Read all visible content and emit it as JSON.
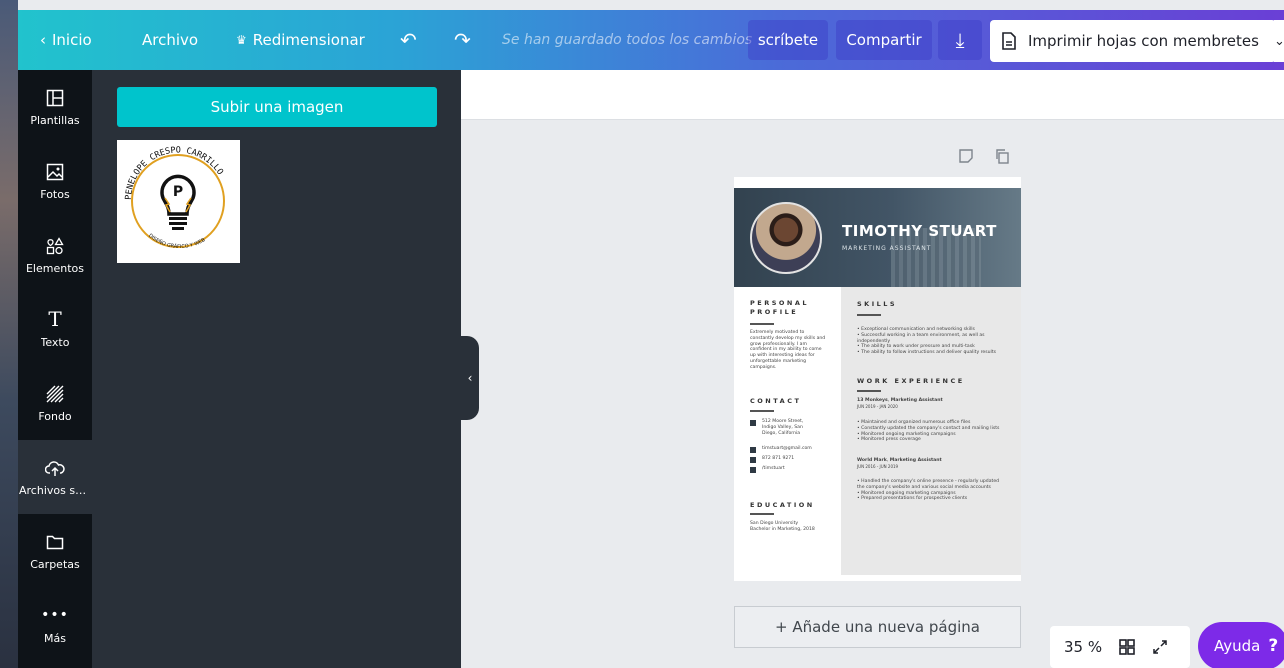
{
  "topbar": {
    "back_label": "Inicio",
    "archivo_label": "Archivo",
    "resize_label": "Redimensionar",
    "saved_status": "Se han guardado todos los cambios",
    "subscribe_label": "scríbete",
    "share_label": "Compartir",
    "print_label": "Imprimir hojas con membretes"
  },
  "rail": {
    "items": [
      {
        "label": "Plantillas",
        "icon": "template-icon"
      },
      {
        "label": "Fotos",
        "icon": "photo-icon"
      },
      {
        "label": "Elementos",
        "icon": "elements-icon"
      },
      {
        "label": "Texto",
        "icon": "text-icon"
      },
      {
        "label": "Fondo",
        "icon": "background-icon"
      },
      {
        "label": "Archivos su...",
        "icon": "upload-icon"
      },
      {
        "label": "Carpetas",
        "icon": "folder-icon"
      },
      {
        "label": "Más",
        "icon": "more-icon"
      }
    ]
  },
  "panel": {
    "upload_label": "Subir una imagen",
    "logo_text_top": "PENELOPE CRESPO CARRILLO",
    "logo_text_bottom": "DISEÑO GRÁFICO Y WEB",
    "logo_letter": "P"
  },
  "resume": {
    "name": "TIMOTHY STUART",
    "role": "MARKETING ASSISTANT",
    "profile_title": "PERSONAL PROFILE",
    "profile_text": "Extremely motivated to constantly develop my skills and grow professionally. I am confident in my ability to come up with interesting ideas for unforgettable marketing campaigns.",
    "contact_title": "CONTACT",
    "address": "512 Moore Street, Indigo Valley, San Diego, California",
    "email": "timstuart@gmail.com",
    "phone": "872 871 9271",
    "linkedin": "/timstuart",
    "education_title": "EDUCATION",
    "education_school": "San Diego University",
    "education_degree": "Bachelor in Marketing, 2018",
    "skills_title": "SKILLS",
    "skills": [
      "Exceptional communication and networking skills",
      "Successful working in a team environment, as well as independently",
      "The ability to work under pressure and multi-task",
      "The ability to follow instructions and deliver quality results"
    ],
    "work_title": "WORK EXPERIENCE",
    "job1_company": "13 Monkeys",
    "job1_role": "Marketing Assistant",
    "job1_dates": "JUN 2019 - JAN 2020",
    "job1_bullets": [
      "Maintained and organized numerous office files",
      "Constantly updated the company's contact and mailing lists",
      "Monitored ongoing marketing campaigns",
      "Monitored press coverage"
    ],
    "job2_company": "World Mark",
    "job2_role": "Marketing Assistant",
    "job2_dates": "JUN 2016 - JUN 2019",
    "job2_bullets": [
      "Handled the company's online presence - regularly updated the company's website and various social media accounts",
      "Monitored ongoing marketing campaigns",
      "Prepared presentations for prospective clients"
    ]
  },
  "canvas": {
    "add_page_label": "+ Añade una nueva página",
    "zoom_value": "35 %",
    "help_label": "Ayuda",
    "help_q": "?"
  }
}
